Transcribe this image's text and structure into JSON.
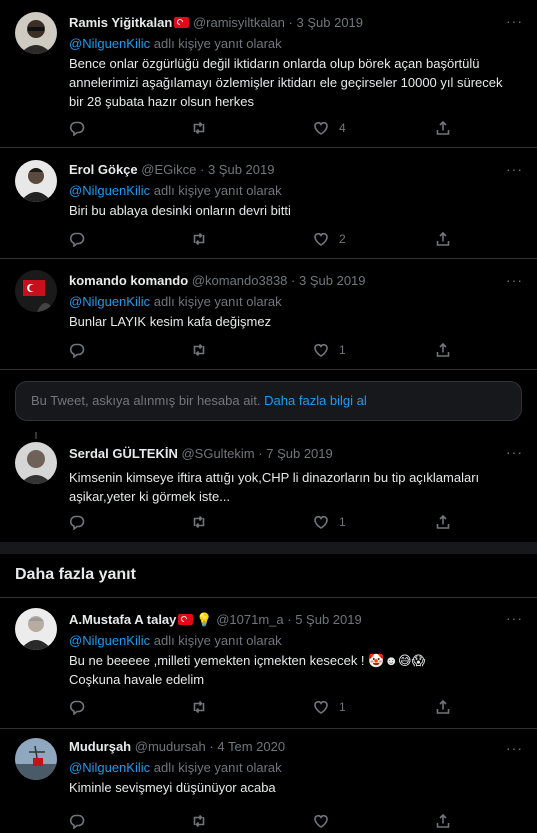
{
  "tweets": [
    {
      "name": "Ramis Yiğitkalan",
      "has_flag": true,
      "handle": "@ramisyiltkalan",
      "date": "3 Şub 2019",
      "reply_prefix": "@NilguenKilic",
      "reply_suffix": " adlı kişiye yanıt olarak",
      "text": "Bence onlar özgürlüğü değil iktidarın onlarda olup börek açan başörtülü annelerimizi aşağılamayı özlemişler iktidarı ele geçirseler 10000 yıl sürecek bir 28 şubata hazır olsun herkes",
      "like_count": "4"
    },
    {
      "name": "Erol Gökçe",
      "handle": "@EGikce",
      "date": "3 Şub 2019",
      "reply_prefix": "@NilguenKilic",
      "reply_suffix": " adlı kişiye yanıt olarak",
      "text": "Biri bu ablaya desinki  onların devri bitti",
      "like_count": "2"
    },
    {
      "name": "komando komando",
      "handle": "@komando3838",
      "date": "3 Şub 2019",
      "reply_prefix": "@NilguenKilic",
      "reply_suffix": " adlı kişiye yanıt olarak",
      "text": "Bunlar LAYIK kesim kafa değişmez",
      "like_count": "1"
    },
    {
      "name": "Serdal GÜLTEKİN",
      "handle": "@SGultekim",
      "date": "7 Şub 2019",
      "text": "Kimsenin kimseye iftira attığı yok,CHP li dinazorların bu tip açıklamaları aşikar,yeter ki görmek iste...",
      "like_count": "1"
    },
    {
      "name": "A.Mustafa A talay",
      "has_flag": true,
      "has_bulb": true,
      "handle": "@1071m_a",
      "date": "5 Şub 2019",
      "reply_prefix": "@NilguenKilic",
      "reply_suffix": " adlı kişiye yanıt olarak",
      "text": "Bu ne beeeee ,milleti yemekten içmekten kesecek ! 🤡☻😅😱",
      "text2": "Coşkuna havale edelim",
      "like_count": "1"
    },
    {
      "name": "Mudurşah",
      "handle": "@mudursah",
      "date": "4 Tem 2020",
      "reply_prefix": "@NilguenKilic",
      "reply_suffix": " adlı kişiye yanıt olarak",
      "text": "Kiminle sevişmeyi düşünüyor acaba",
      "like_count": ""
    }
  ],
  "separator": "·",
  "more_glyph": "···",
  "notice": {
    "text": "Bu Tweet, askıya alınmış bir hesaba ait. ",
    "link": "Daha fazla bilgi al"
  },
  "section_title": "Daha fazla yanıt",
  "icons": [
    "reply-icon",
    "retweet-icon",
    "like-icon",
    "share-icon"
  ],
  "colors": {
    "background": "#000000",
    "accent": "#1d9bf0",
    "muted": "#71767b",
    "border": "#2f3336"
  }
}
